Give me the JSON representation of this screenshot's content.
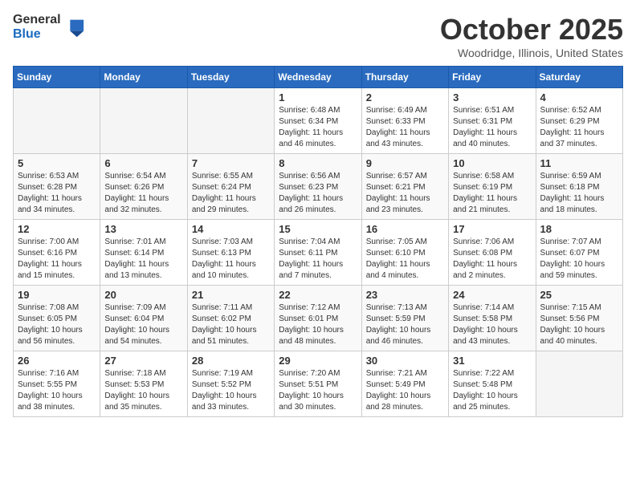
{
  "logo": {
    "general": "General",
    "blue": "Blue"
  },
  "title": "October 2025",
  "location": "Woodridge, Illinois, United States",
  "headers": [
    "Sunday",
    "Monday",
    "Tuesday",
    "Wednesday",
    "Thursday",
    "Friday",
    "Saturday"
  ],
  "weeks": [
    [
      {
        "day": "",
        "info": ""
      },
      {
        "day": "",
        "info": ""
      },
      {
        "day": "",
        "info": ""
      },
      {
        "day": "1",
        "info": "Sunrise: 6:48 AM\nSunset: 6:34 PM\nDaylight: 11 hours and 46 minutes."
      },
      {
        "day": "2",
        "info": "Sunrise: 6:49 AM\nSunset: 6:33 PM\nDaylight: 11 hours and 43 minutes."
      },
      {
        "day": "3",
        "info": "Sunrise: 6:51 AM\nSunset: 6:31 PM\nDaylight: 11 hours and 40 minutes."
      },
      {
        "day": "4",
        "info": "Sunrise: 6:52 AM\nSunset: 6:29 PM\nDaylight: 11 hours and 37 minutes."
      }
    ],
    [
      {
        "day": "5",
        "info": "Sunrise: 6:53 AM\nSunset: 6:28 PM\nDaylight: 11 hours and 34 minutes."
      },
      {
        "day": "6",
        "info": "Sunrise: 6:54 AM\nSunset: 6:26 PM\nDaylight: 11 hours and 32 minutes."
      },
      {
        "day": "7",
        "info": "Sunrise: 6:55 AM\nSunset: 6:24 PM\nDaylight: 11 hours and 29 minutes."
      },
      {
        "day": "8",
        "info": "Sunrise: 6:56 AM\nSunset: 6:23 PM\nDaylight: 11 hours and 26 minutes."
      },
      {
        "day": "9",
        "info": "Sunrise: 6:57 AM\nSunset: 6:21 PM\nDaylight: 11 hours and 23 minutes."
      },
      {
        "day": "10",
        "info": "Sunrise: 6:58 AM\nSunset: 6:19 PM\nDaylight: 11 hours and 21 minutes."
      },
      {
        "day": "11",
        "info": "Sunrise: 6:59 AM\nSunset: 6:18 PM\nDaylight: 11 hours and 18 minutes."
      }
    ],
    [
      {
        "day": "12",
        "info": "Sunrise: 7:00 AM\nSunset: 6:16 PM\nDaylight: 11 hours and 15 minutes."
      },
      {
        "day": "13",
        "info": "Sunrise: 7:01 AM\nSunset: 6:14 PM\nDaylight: 11 hours and 13 minutes."
      },
      {
        "day": "14",
        "info": "Sunrise: 7:03 AM\nSunset: 6:13 PM\nDaylight: 11 hours and 10 minutes."
      },
      {
        "day": "15",
        "info": "Sunrise: 7:04 AM\nSunset: 6:11 PM\nDaylight: 11 hours and 7 minutes."
      },
      {
        "day": "16",
        "info": "Sunrise: 7:05 AM\nSunset: 6:10 PM\nDaylight: 11 hours and 4 minutes."
      },
      {
        "day": "17",
        "info": "Sunrise: 7:06 AM\nSunset: 6:08 PM\nDaylight: 11 hours and 2 minutes."
      },
      {
        "day": "18",
        "info": "Sunrise: 7:07 AM\nSunset: 6:07 PM\nDaylight: 10 hours and 59 minutes."
      }
    ],
    [
      {
        "day": "19",
        "info": "Sunrise: 7:08 AM\nSunset: 6:05 PM\nDaylight: 10 hours and 56 minutes."
      },
      {
        "day": "20",
        "info": "Sunrise: 7:09 AM\nSunset: 6:04 PM\nDaylight: 10 hours and 54 minutes."
      },
      {
        "day": "21",
        "info": "Sunrise: 7:11 AM\nSunset: 6:02 PM\nDaylight: 10 hours and 51 minutes."
      },
      {
        "day": "22",
        "info": "Sunrise: 7:12 AM\nSunset: 6:01 PM\nDaylight: 10 hours and 48 minutes."
      },
      {
        "day": "23",
        "info": "Sunrise: 7:13 AM\nSunset: 5:59 PM\nDaylight: 10 hours and 46 minutes."
      },
      {
        "day": "24",
        "info": "Sunrise: 7:14 AM\nSunset: 5:58 PM\nDaylight: 10 hours and 43 minutes."
      },
      {
        "day": "25",
        "info": "Sunrise: 7:15 AM\nSunset: 5:56 PM\nDaylight: 10 hours and 40 minutes."
      }
    ],
    [
      {
        "day": "26",
        "info": "Sunrise: 7:16 AM\nSunset: 5:55 PM\nDaylight: 10 hours and 38 minutes."
      },
      {
        "day": "27",
        "info": "Sunrise: 7:18 AM\nSunset: 5:53 PM\nDaylight: 10 hours and 35 minutes."
      },
      {
        "day": "28",
        "info": "Sunrise: 7:19 AM\nSunset: 5:52 PM\nDaylight: 10 hours and 33 minutes."
      },
      {
        "day": "29",
        "info": "Sunrise: 7:20 AM\nSunset: 5:51 PM\nDaylight: 10 hours and 30 minutes."
      },
      {
        "day": "30",
        "info": "Sunrise: 7:21 AM\nSunset: 5:49 PM\nDaylight: 10 hours and 28 minutes."
      },
      {
        "day": "31",
        "info": "Sunrise: 7:22 AM\nSunset: 5:48 PM\nDaylight: 10 hours and 25 minutes."
      },
      {
        "day": "",
        "info": ""
      }
    ]
  ]
}
